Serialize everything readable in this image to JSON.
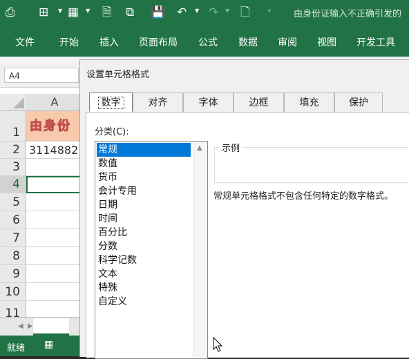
{
  "titlebar": {
    "title": "由身份证输入不正确引发的"
  },
  "ribbon": {
    "tabs": [
      "文件",
      "开始",
      "插入",
      "页面布局",
      "公式",
      "数据",
      "审阅",
      "视图",
      "开发工具"
    ]
  },
  "formula_bar": {
    "name_box": "A4"
  },
  "sheet": {
    "column_header": "A",
    "row_numbers": [
      "1",
      "2",
      "3",
      "4",
      "5",
      "6",
      "7",
      "8",
      "9",
      "10",
      "11"
    ],
    "a1": "由身份",
    "a2": "3114882"
  },
  "statusbar": {
    "ready": "就绪"
  },
  "dialog": {
    "title": "设置单元格格式",
    "tabs": [
      "数字",
      "对齐",
      "字体",
      "边框",
      "填充",
      "保护"
    ],
    "category_label": "分类(C):",
    "categories": [
      "常规",
      "数值",
      "货币",
      "会计专用",
      "日期",
      "时间",
      "百分比",
      "分数",
      "科学记数",
      "文本",
      "特殊",
      "自定义"
    ],
    "selected_category": "常规",
    "sample_label": "示例",
    "description": "常规单元格格式不包含任何特定的数字格式。"
  },
  "colors": {
    "excel_green": "#217346",
    "selection_blue": "#0078d7",
    "header_fill": "#f7caac"
  }
}
